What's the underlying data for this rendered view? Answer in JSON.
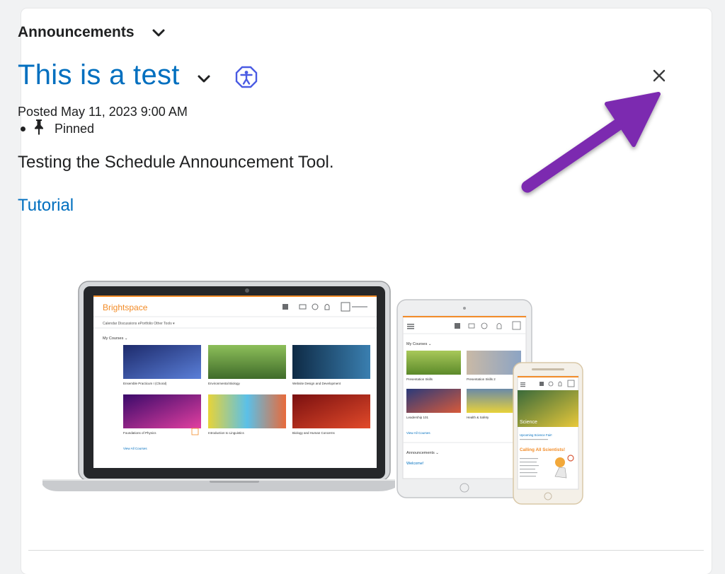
{
  "widget": {
    "title": "Announcements"
  },
  "announcement": {
    "title": "This is a test",
    "posted": "Posted May 11, 2023 9:00 AM",
    "pinned_label": "Pinned",
    "body": "Testing the Schedule Announcement Tool.",
    "link_text": "Tutorial"
  },
  "image": {
    "laptop": {
      "brand": "Brightspace",
      "nav": "Calendar   Discussions   ePortfolio   Other Tools ▾",
      "section": "My Courses  ⌄",
      "courses": [
        "Ensemble Practicum I (Choral)",
        "Environmental Biology",
        "Website Design and Development",
        "Foundations of Physics",
        "Introduction to Linguistics",
        "Biology and Human Concerns"
      ],
      "view_all": "View All Courses"
    },
    "tablet": {
      "section": "My Courses  ⌄",
      "courses": [
        "Presentation Skills",
        "Presentation Skills 2",
        "Leadership 101",
        "Health & Safety"
      ],
      "view_all": "View All Courses",
      "announcements": "Announcements  ⌄",
      "welcome": "Welcome!"
    },
    "phone": {
      "banner": "Science",
      "item": "Upcoming Science Fair!",
      "headline": "Calling All Scientists!"
    }
  },
  "colors": {
    "link": "#006fbf",
    "arrow": "#7b2ab0",
    "accent": "#f28c28"
  }
}
